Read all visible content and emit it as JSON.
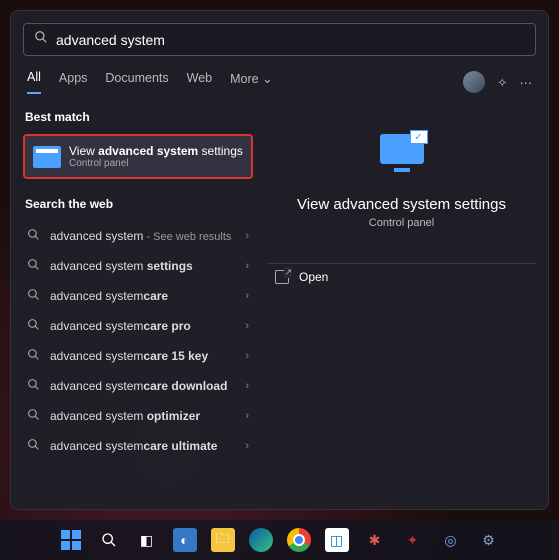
{
  "search": {
    "query": "advanced system"
  },
  "tabs": {
    "items": [
      "All",
      "Apps",
      "Documents",
      "Web",
      "More"
    ],
    "active_index": 0
  },
  "left": {
    "best_match_header": "Best match",
    "best_match": {
      "title_prefix": "View ",
      "title_bold": "advanced system",
      "title_suffix": " settings",
      "subtitle": "Control panel"
    },
    "web_header": "Search the web",
    "web_items": [
      {
        "prefix": "advanced system",
        "bold": "",
        "suffix_text": " - See web results"
      },
      {
        "prefix": "advanced system ",
        "bold": "settings",
        "suffix_text": ""
      },
      {
        "prefix": "advanced system",
        "bold": "care",
        "suffix_text": ""
      },
      {
        "prefix": "advanced system",
        "bold": "care pro",
        "suffix_text": ""
      },
      {
        "prefix": "advanced system",
        "bold": "care 15 key",
        "suffix_text": ""
      },
      {
        "prefix": "advanced system",
        "bold": "care download",
        "suffix_text": ""
      },
      {
        "prefix": "advanced system ",
        "bold": "optimizer",
        "suffix_text": ""
      },
      {
        "prefix": "advanced system",
        "bold": "care ultimate",
        "suffix_text": ""
      }
    ]
  },
  "right": {
    "title": "View advanced system settings",
    "subtitle": "Control panel",
    "open_label": "Open"
  },
  "taskbar": {
    "icons": [
      "start",
      "search",
      "task-view",
      "widgets",
      "explorer",
      "edge",
      "chrome",
      "store",
      "app1",
      "app2",
      "app3",
      "settings"
    ]
  }
}
